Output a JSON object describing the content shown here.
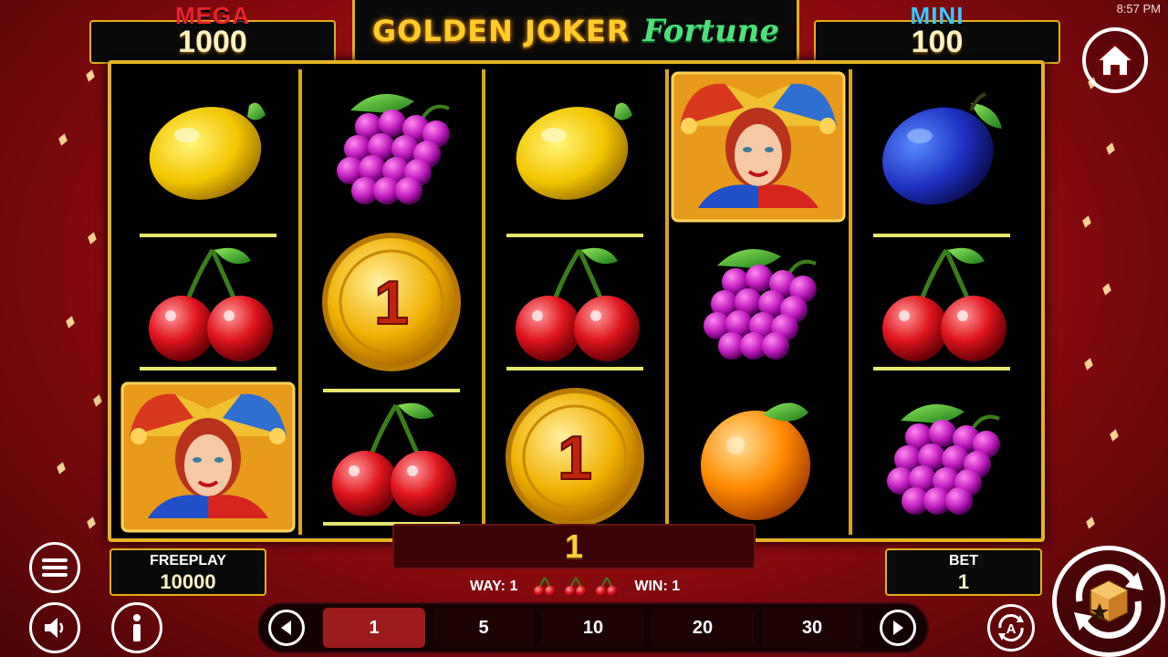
{
  "status_bar": {
    "time": "8:57 PM"
  },
  "jackpots": {
    "mega": {
      "label": "MEGA",
      "value": "1000",
      "color": "#e8232b"
    },
    "mini": {
      "label": "MINI",
      "value": "100",
      "color": "#3ec6ff"
    }
  },
  "logo": {
    "part1": "GOLDEN JOKER",
    "part2": "Fortune"
  },
  "reels": [
    [
      "lemon",
      "cherry",
      "joker"
    ],
    [
      "grapes",
      "coin",
      "cherry"
    ],
    [
      "lemon",
      "cherry",
      "coin"
    ],
    [
      "joker",
      "grapes",
      "orange"
    ],
    [
      "plum",
      "cherry",
      "grapes"
    ]
  ],
  "coin_value": "1",
  "win_display": "1",
  "freeplay": {
    "label": "FREEPLAY",
    "value": "10000"
  },
  "bet": {
    "label": "BET",
    "value": "1"
  },
  "way_line": {
    "way": "WAY: 1",
    "win": "WIN: 1"
  },
  "bet_options": [
    "1",
    "5",
    "10",
    "20",
    "30"
  ],
  "selected_bet": "1",
  "icons": [
    "home-icon",
    "menu-icon",
    "sound-icon",
    "info-icon",
    "prev-arrow-icon",
    "next-arrow-icon",
    "autoplay-icon",
    "spin-icon"
  ]
}
